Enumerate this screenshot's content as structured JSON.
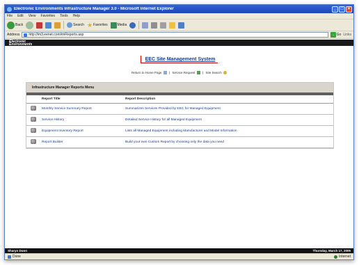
{
  "window": {
    "title": "Electronic Environments Infrastructure Manager 3.0 - Microsoft Internet Explorer"
  },
  "menubar": [
    "File",
    "Edit",
    "View",
    "Favorites",
    "Tools",
    "Help"
  ],
  "toolbar": {
    "back": "Back",
    "search": "Search",
    "favorites": "Favorites",
    "media": "Media"
  },
  "addressbar": {
    "label": "Address",
    "url": "http://im3.eenet.com/imReports.asp",
    "go": "Go",
    "links": "Links"
  },
  "brand": {
    "line1": "Electronic",
    "line2": "Environments"
  },
  "header": {
    "system_title": "EEC Site Management System",
    "nav": {
      "home": "Return to Home Page",
      "service_request": "Service Request",
      "site_search": "Site Search"
    }
  },
  "reports": {
    "panel_title": "Infrastructure Manager Reports Menu",
    "columns": {
      "title": "Report Title",
      "description": "Report Description"
    },
    "rows": [
      {
        "title": "Monthly Service Summary Report",
        "description": "Summarizes Services Provided by EEC for Managed Equipment"
      },
      {
        "title": "Service History",
        "description": "Detailed Service History for all Managed Equipment"
      },
      {
        "title": "Equipment Inventory Report",
        "description": "Lists all Managed Equipment including Manufacturer and Model Information"
      },
      {
        "title": "Report Builder",
        "description": "Build your own Custom Report by choosing only the data you need"
      }
    ]
  },
  "app_status": {
    "user": "Sharyn Dunn",
    "date": "Thursday, March 17, 2005"
  },
  "ie_status": {
    "left": "Done",
    "zone": "Internet"
  }
}
